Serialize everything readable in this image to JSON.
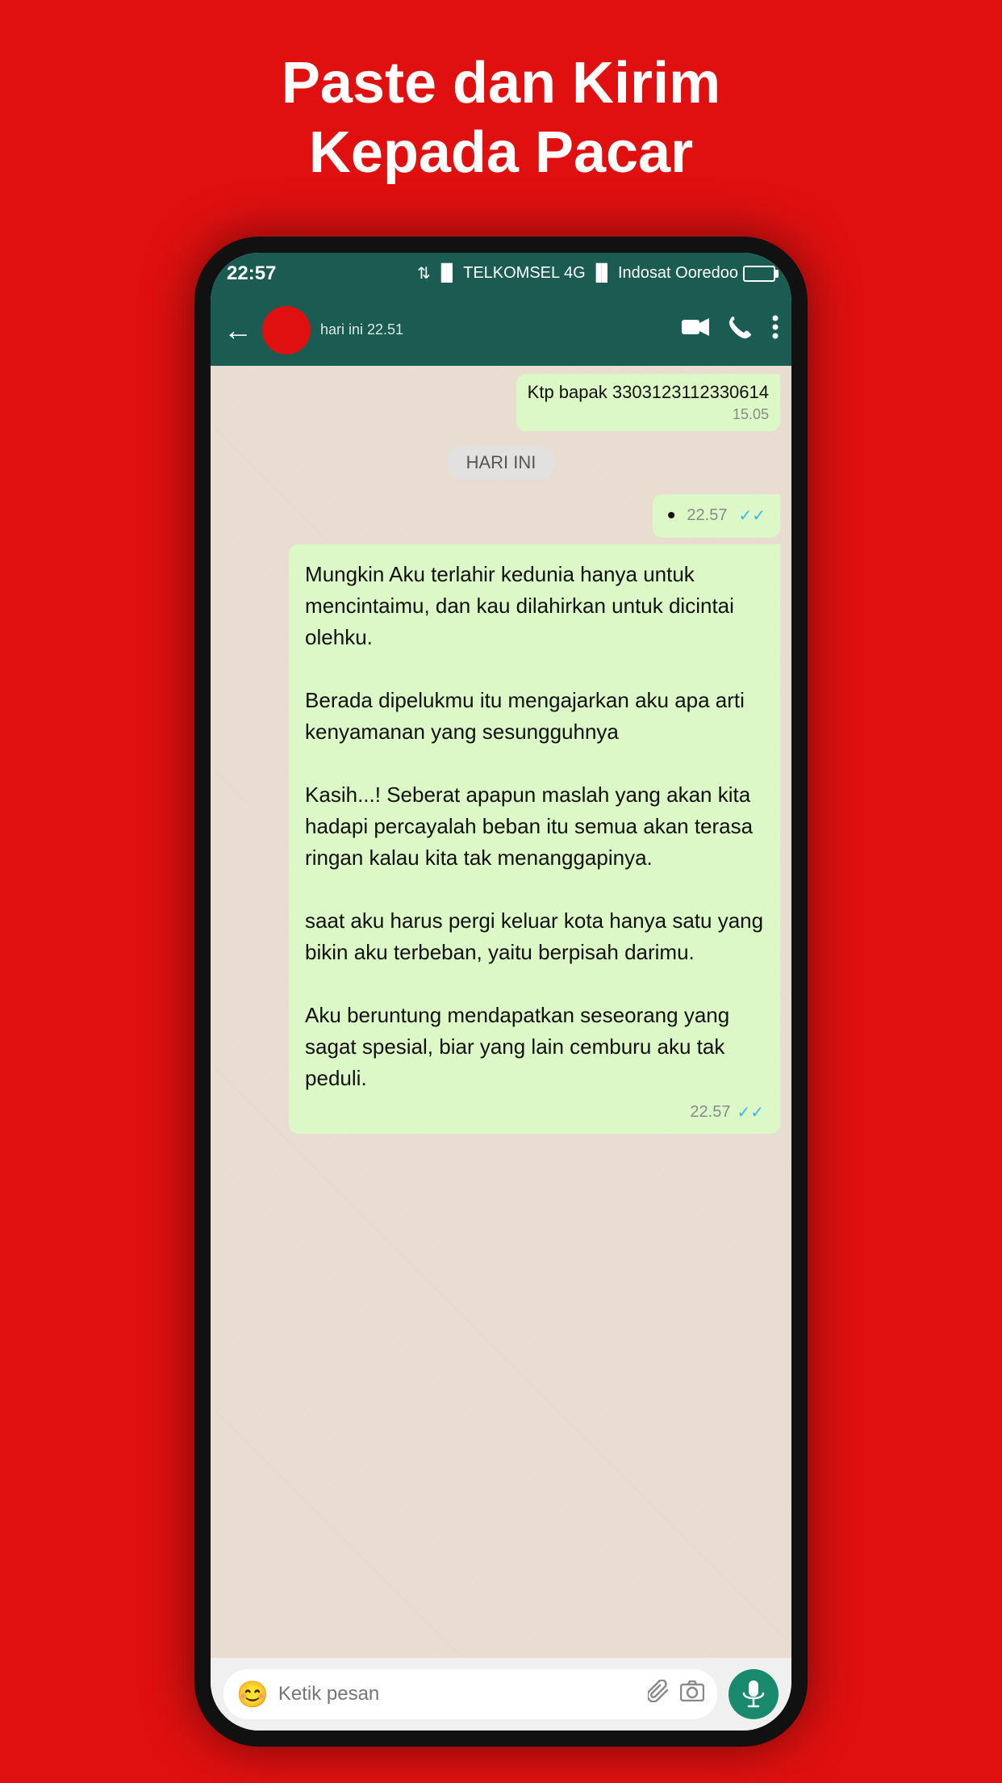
{
  "header": {
    "title": "Paste dan Kirim",
    "subtitle": "Kepada Pacar"
  },
  "status_bar": {
    "time": "22:57",
    "carrier1": "TELKOMSEL 4G",
    "carrier2": "Indosat Ooredoo"
  },
  "wa_header": {
    "contact_name": "",
    "last_seen": "hari ini 22.51",
    "back_label": "←",
    "video_call_label": "📹",
    "phone_label": "📞",
    "menu_label": "⋮"
  },
  "chat": {
    "prev_message": {
      "text": "Ktp bapak 3303123112330614",
      "time": "15.05"
    },
    "day_label": "HARI INI",
    "dot_message": {
      "dot": "•",
      "time": "22.57",
      "checks": "✓✓"
    },
    "main_message": {
      "text": "Mungkin Aku terlahir kedunia hanya untuk mencintaimu, dan kau dilahirkan untuk dicintai olehku.\n\nBerada dipelukmu itu mengajarkan aku apa arti kenyamanan yang sesungguhnya\n\nKasih...! Seberat apapun maslah yang akan kita hadapi percayalah beban itu semua akan terasa ringan kalau kita tak menanggapinya.\n\nsaat aku harus pergi keluar kota hanya satu yang bikin aku terbeban, yaitu berpisah darimu.\n\nAku beruntung mendapatkan seseorang yang sagat spesial, biar yang lain cemburu aku tak peduli.",
      "time": "22.57",
      "checks": "✓✓"
    }
  },
  "input_bar": {
    "placeholder": "Ketik pesan",
    "emoji_label": "😊",
    "attach_label": "📎",
    "camera_label": "📷",
    "mic_label": "🎤"
  }
}
